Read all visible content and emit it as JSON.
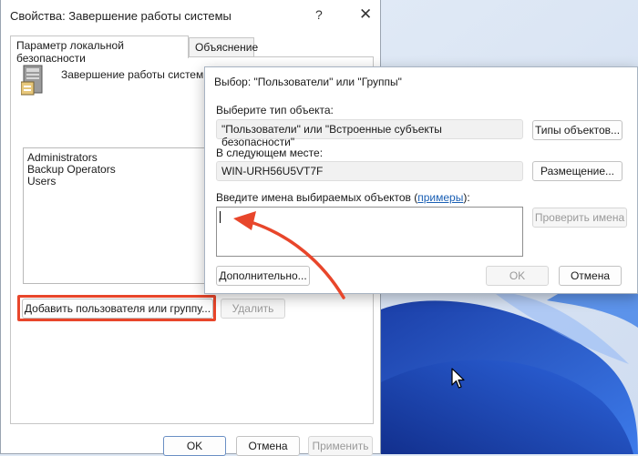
{
  "back_dialog": {
    "title": "Свойства: Завершение работы системы",
    "help_glyph": "?",
    "close_glyph": "✕",
    "tabs": [
      {
        "label": "Параметр локальной безопасности",
        "active": true
      },
      {
        "label": "Объяснение",
        "active": false
      }
    ],
    "policy_title": "Завершение работы системы",
    "users": [
      "Administrators",
      "Backup Operators",
      "Users"
    ],
    "add_button": "Добавить пользователя или группу...",
    "remove_button": "Удалить",
    "ok_button": "OK",
    "cancel_button": "Отмена",
    "apply_button": "Применить"
  },
  "select_dialog": {
    "title": "Выбор: \"Пользователи\" или \"Группы\"",
    "object_type_label": "Выберите тип объекта:",
    "object_type_value": "\"Пользователи\" или \"Встроенные субъекты безопасности\"",
    "object_types_button": "Типы объектов...",
    "location_label": "В следующем месте:",
    "location_value": "WIN-URH56U5VT7F",
    "locations_button": "Размещение...",
    "names_label": "Введите имена выбираемых объектов (",
    "names_link": "примеры",
    "names_label_end": "):",
    "names_value": "",
    "check_names_button": "Проверить имена",
    "advanced_button": "Дополнительно...",
    "ok_button": "OK",
    "cancel_button": "Отмена"
  },
  "colors": {
    "highlight": "#e8462b",
    "link": "#1a5fb4",
    "wallpaper_blue": "#1f4fd1"
  }
}
